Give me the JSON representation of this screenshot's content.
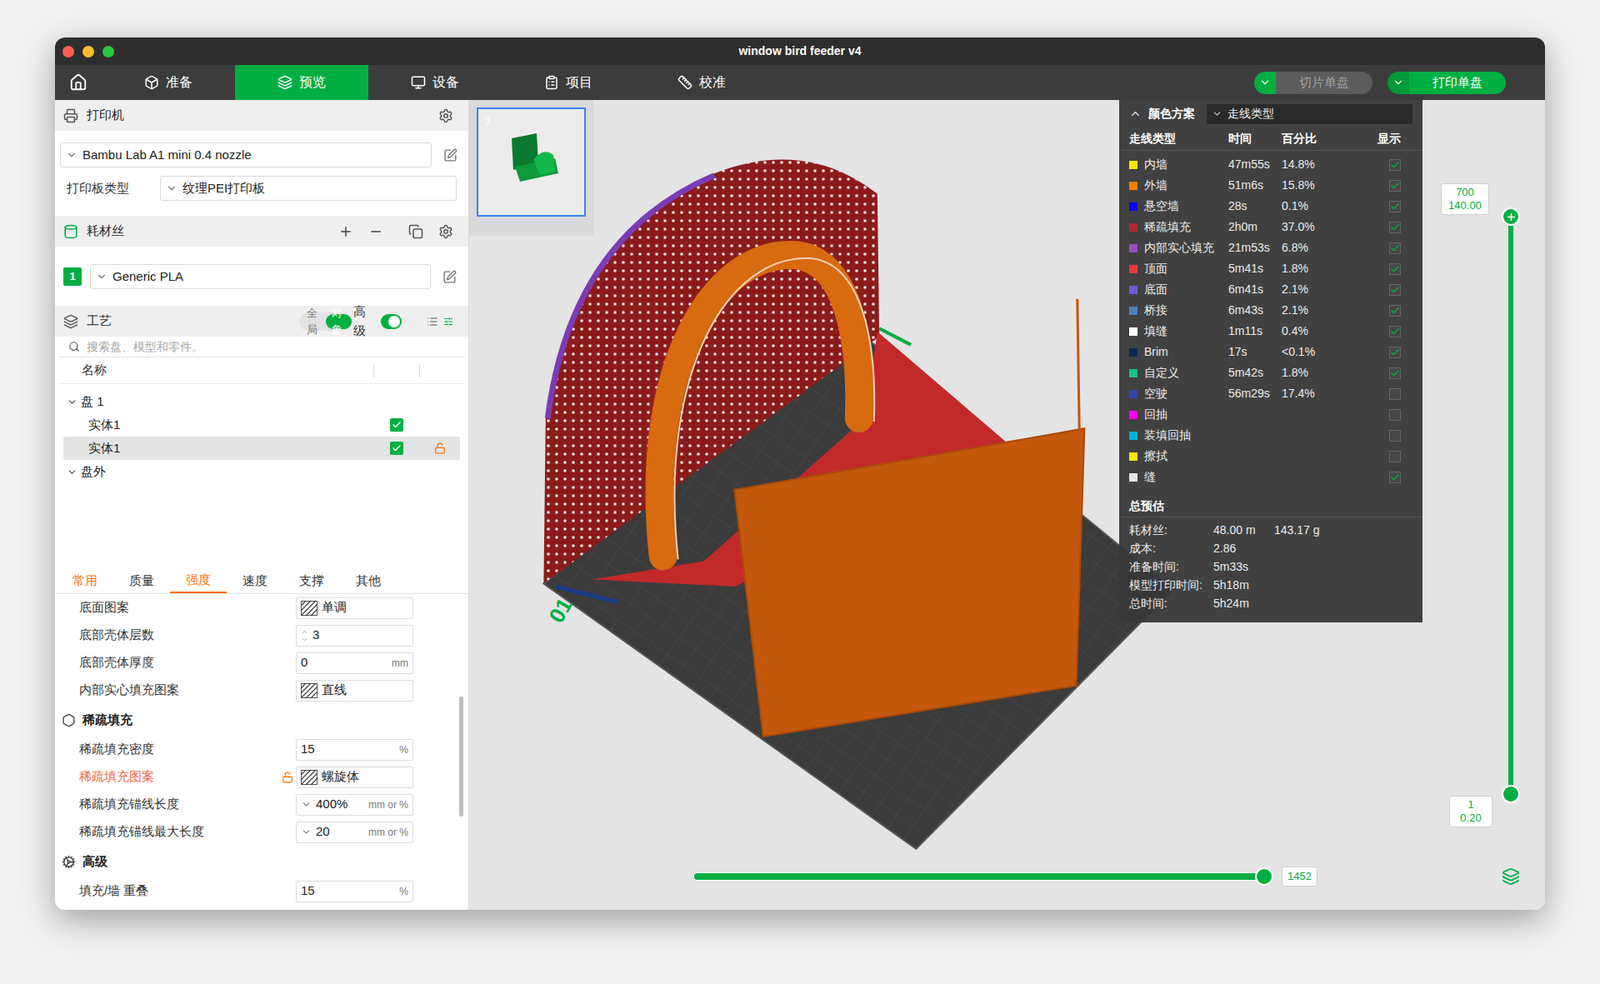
{
  "window": {
    "title": "window bird feeder v4"
  },
  "nav": {
    "tabs": [
      {
        "label": "准备",
        "selected": false
      },
      {
        "label": "预览",
        "selected": true
      },
      {
        "label": "设备",
        "selected": false
      },
      {
        "label": "项目",
        "selected": false
      },
      {
        "label": "校准",
        "selected": false
      }
    ],
    "slice_button": {
      "label": "切片单盘",
      "disabled": true
    },
    "print_button": {
      "label": "打印单盘",
      "disabled": false
    }
  },
  "printer": {
    "title": "打印机",
    "model": "Bambu Lab A1 mini 0.4 nozzle",
    "plate_label": "打印板类型",
    "plate": "纹理PEI打印板"
  },
  "filament": {
    "title": "耗材丝",
    "items": [
      {
        "index": "1",
        "name": "Generic PLA",
        "color": "#00ae42"
      }
    ]
  },
  "process": {
    "title": "工艺",
    "modes": [
      {
        "label": "全局",
        "selected": false
      },
      {
        "label": "对象",
        "selected": true
      }
    ],
    "advanced": {
      "label": "高级",
      "on": true
    },
    "search_placeholder": "搜索盘、模型和零件。",
    "column": "名称",
    "tree": [
      {
        "label": "盘 1",
        "kind": "group",
        "expanded": true,
        "selected": false
      },
      {
        "label": "实体1",
        "kind": "object",
        "checked": true,
        "locked": false,
        "selected": false
      },
      {
        "label": "实体1",
        "kind": "object",
        "checked": true,
        "locked": true,
        "selected": true
      },
      {
        "label": "盘外",
        "kind": "group",
        "expanded": true,
        "selected": false
      }
    ],
    "settings_tabs": [
      {
        "label": "常用",
        "selected": false,
        "modified": true
      },
      {
        "label": "质量",
        "selected": false,
        "modified": false
      },
      {
        "label": "强度",
        "selected": true,
        "modified": true
      },
      {
        "label": "速度",
        "selected": false,
        "modified": false
      },
      {
        "label": "支撑",
        "selected": false,
        "modified": false
      },
      {
        "label": "其他",
        "selected": false,
        "modified": false
      }
    ],
    "settings": [
      {
        "kind": "pattern",
        "label": "底面图案",
        "value": "单调",
        "unit": "",
        "modified": false,
        "locked": false
      },
      {
        "kind": "spin",
        "label": "底部壳体层数",
        "value": "3",
        "unit": "",
        "modified": false,
        "locked": false
      },
      {
        "kind": "input",
        "label": "底部壳体厚度",
        "value": "0",
        "unit": "mm",
        "modified": false,
        "locked": false
      },
      {
        "kind": "pattern",
        "label": "内部实心填充图案",
        "value": "直线",
        "unit": "",
        "modified": false,
        "locked": false
      },
      {
        "kind": "section",
        "label": "稀疏填充"
      },
      {
        "kind": "input",
        "label": "稀疏填充密度",
        "value": "15",
        "unit": "%",
        "modified": false,
        "locked": false
      },
      {
        "kind": "pattern",
        "label": "稀疏填充图案",
        "value": "螺旋体",
        "unit": "",
        "modified": true,
        "locked": true
      },
      {
        "kind": "combo",
        "label": "稀疏填充锚线长度",
        "value": "400%",
        "unit": "mm or %",
        "modified": false,
        "locked": false
      },
      {
        "kind": "combo",
        "label": "稀疏填充锚线最大长度",
        "value": "20",
        "unit": "mm or %",
        "modified": false,
        "locked": false
      },
      {
        "kind": "section",
        "label": "高级"
      },
      {
        "kind": "input",
        "label": "填充/墙 重叠",
        "value": "15",
        "unit": "%",
        "modified": false,
        "locked": false
      }
    ]
  },
  "viewport": {
    "plate_thumbnail": {
      "label": "1",
      "selected": true
    },
    "bed_label": "01",
    "legend": {
      "title": "颜色方案",
      "scheme": "走线类型",
      "columns": [
        "走线类型",
        "时间",
        "百分比",
        "显示"
      ],
      "rows": [
        {
          "name": "内墙",
          "time": "47m55s",
          "percent": "14.8%",
          "color": "#ffe600",
          "visible": true
        },
        {
          "name": "外墙",
          "time": "51m6s",
          "percent": "15.8%",
          "color": "#ff7d00",
          "visible": true
        },
        {
          "name": "悬空墙",
          "time": "28s",
          "percent": "0.1%",
          "color": "#0000ff",
          "visible": true
        },
        {
          "name": "稀疏填充",
          "time": "2h0m",
          "percent": "37.0%",
          "color": "#b02a2a",
          "visible": true
        },
        {
          "name": "内部实心填充",
          "time": "21m53s",
          "percent": "6.8%",
          "color": "#9a4fc9",
          "visible": true
        },
        {
          "name": "顶面",
          "time": "5m41s",
          "percent": "1.8%",
          "color": "#f03a3a",
          "visible": true
        },
        {
          "name": "底面",
          "time": "6m41s",
          "percent": "2.1%",
          "color": "#6a5bd6",
          "visible": true
        },
        {
          "name": "桥接",
          "time": "6m43s",
          "percent": "2.1%",
          "color": "#4f7fc0",
          "visible": true
        },
        {
          "name": "填缝",
          "time": "1m11s",
          "percent": "0.4%",
          "color": "#ffffff",
          "visible": true
        },
        {
          "name": "Brim",
          "time": "17s",
          "percent": "<0.1%",
          "color": "#0b2a55",
          "visible": true
        },
        {
          "name": "自定义",
          "time": "5m42s",
          "percent": "1.8%",
          "color": "#14c08c",
          "visible": true
        },
        {
          "name": "空驶",
          "time": "56m29s",
          "percent": "17.4%",
          "color": "#3446a8",
          "visible": false
        },
        {
          "name": "回抽",
          "time": "",
          "percent": "",
          "color": "#ff00ff",
          "visible": false
        },
        {
          "name": "装填回抽",
          "time": "",
          "percent": "",
          "color": "#00b4d8",
          "visible": false
        },
        {
          "name": "擦拭",
          "time": "",
          "percent": "",
          "color": "#ffe600",
          "visible": false
        },
        {
          "name": "缝",
          "time": "",
          "percent": "",
          "color": "#e6e6e6",
          "visible": true
        }
      ],
      "total": {
        "title": "总预估",
        "rows": [
          {
            "label": "耗材丝:",
            "value": "48.00 m",
            "extra": "143.17 g"
          },
          {
            "label": "成本:",
            "value": "2.86",
            "extra": ""
          },
          {
            "label": "准备时间:",
            "value": "5m33s",
            "extra": ""
          },
          {
            "label": "模型打印时间:",
            "value": "5h18m",
            "extra": ""
          },
          {
            "label": "总时间:",
            "value": "5h24m",
            "extra": ""
          }
        ]
      }
    },
    "layer_slider": {
      "top_value": "700",
      "top_height": "140.00",
      "bottom_value": "1",
      "bottom_height": "0.20",
      "upper": 1,
      "lower": 0
    },
    "move_slider": {
      "value": "1452",
      "level": 1
    }
  }
}
